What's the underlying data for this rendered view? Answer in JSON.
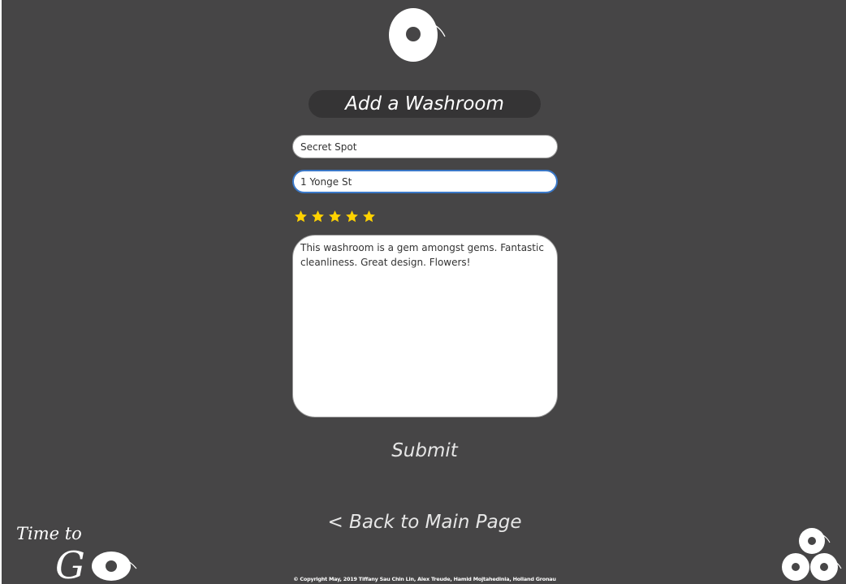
{
  "header": {
    "logo_icon": "toilet-paper-roll-icon"
  },
  "form": {
    "title": "Add a Washroom",
    "name_value": "Secret Spot",
    "address_value": "1 Yonge St",
    "rating": 5,
    "rating_max": 5,
    "star_color": "#ffd200",
    "review_text": "This washroom is a gem amongst gems. Fantastic cleanliness. Great design. Flowers!",
    "submit_label": "Submit"
  },
  "nav": {
    "back_label": "< Back to Main Page"
  },
  "footer": {
    "brand_line1": "Time to",
    "brand_line2": "G",
    "corner_icon": "toilet-paper-stack-icon",
    "copyright": "© Copyright May, 2019 Tiffany Sau Chin Lin, Alex Treude, Hamid Mojtahedinia, Holland Gronau"
  },
  "theme": {
    "background": "#464546",
    "title_pill": "#353435",
    "focus_border": "#3a78c8"
  }
}
